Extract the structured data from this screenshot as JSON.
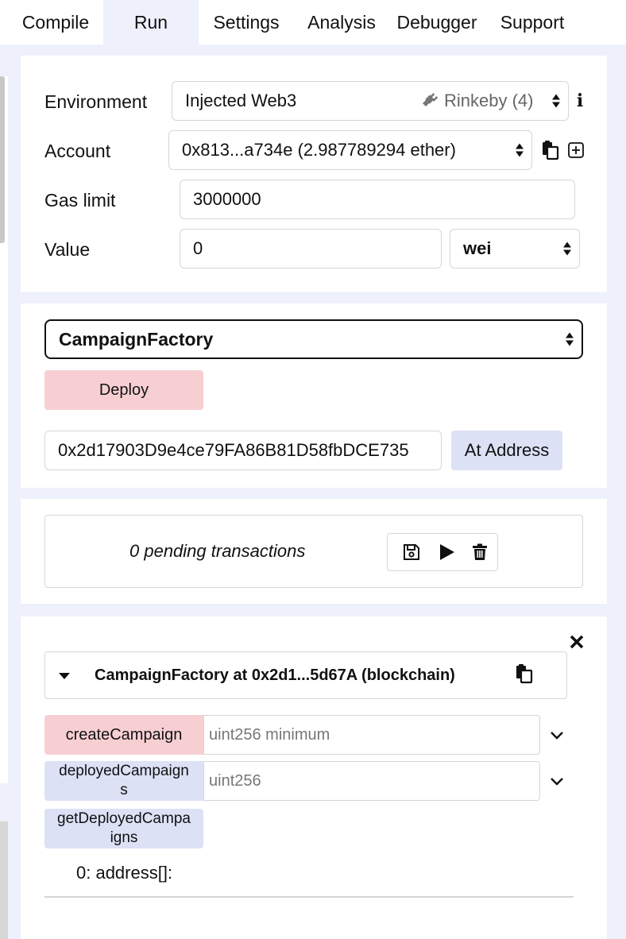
{
  "tabs": [
    {
      "label": "Compile",
      "active": false
    },
    {
      "label": "Run",
      "active": true
    },
    {
      "label": "Settings",
      "active": false
    },
    {
      "label": "Analysis",
      "active": false
    },
    {
      "label": "Debugger",
      "active": false
    },
    {
      "label": "Support",
      "active": false
    }
  ],
  "settings": {
    "environment_label": "Environment",
    "environment_value": "Injected Web3",
    "network_value": "Rinkeby (4)",
    "account_label": "Account",
    "account_value": "0x813...a734e (2.987789294 ether)",
    "gas_limit_label": "Gas limit",
    "gas_limit_value": "3000000",
    "value_label": "Value",
    "value_value": "0",
    "unit_value": "wei"
  },
  "deploy": {
    "contract_value": "CampaignFactory",
    "deploy_label": "Deploy",
    "address_value": "0x2d17903D9e4ce79FA86B81D58fbDCE735",
    "at_address_label": "At Address"
  },
  "pending": {
    "text": "0 pending transactions"
  },
  "instance": {
    "title": "CampaignFactory at 0x2d1...5d67A (blockchain)",
    "functions": [
      {
        "label": "createCampaign",
        "placeholder": "uint256 minimum",
        "color": "pink"
      },
      {
        "label": "deployedCampaigns",
        "placeholder": "uint256",
        "color": "blue"
      },
      {
        "label": "getDeployedCampaigns",
        "color": "blue"
      }
    ],
    "output": "0: address[]:"
  },
  "colors": {
    "accent_bg": "#eef0fb",
    "transact_button": "#f7cfd3",
    "call_button": "#dde1f6"
  }
}
